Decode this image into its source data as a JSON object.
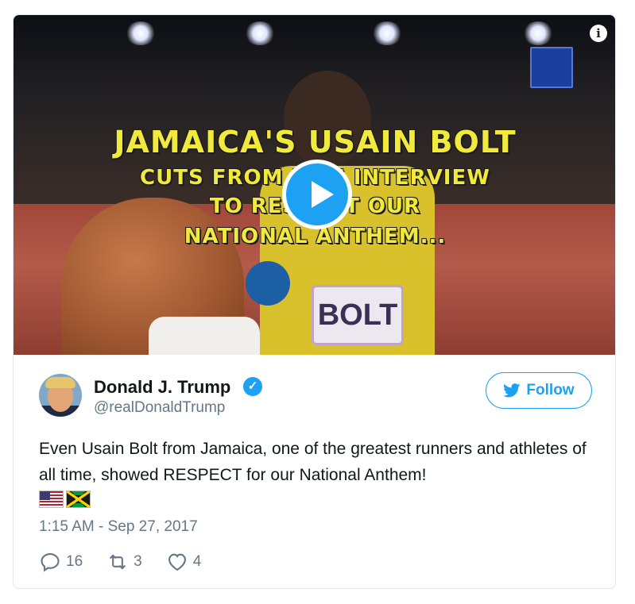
{
  "media": {
    "headline_lines": [
      "JAMAICA'S USAIN BOLT",
      "CUTS FROM LIVE INTERVIEW",
      "TO RESPECT OUR",
      "NATIONAL ANTHEM..."
    ],
    "bib_text": "BOLT",
    "play_icon": "play-icon",
    "info_icon": "info-icon"
  },
  "author": {
    "name": "Donald J. Trump",
    "handle": "@realDonaldTrump",
    "verified_icon": "verified-icon"
  },
  "follow": {
    "label": "Follow",
    "icon": "twitter-bird-icon"
  },
  "tweet": {
    "text": "Even Usain Bolt from Jamaica, one of the greatest runners and athletes of all time, showed RESPECT for our National Anthem!",
    "emoji": [
      "flag-us",
      "flag-jamaica"
    ],
    "timestamp": "1:15 AM - Sep 27, 2017"
  },
  "stats": {
    "replies": "16",
    "retweets": "3",
    "likes": "4"
  },
  "colors": {
    "accent": "#1da1f2",
    "secondary_text": "#657786",
    "headline": "#f1ea3c"
  }
}
